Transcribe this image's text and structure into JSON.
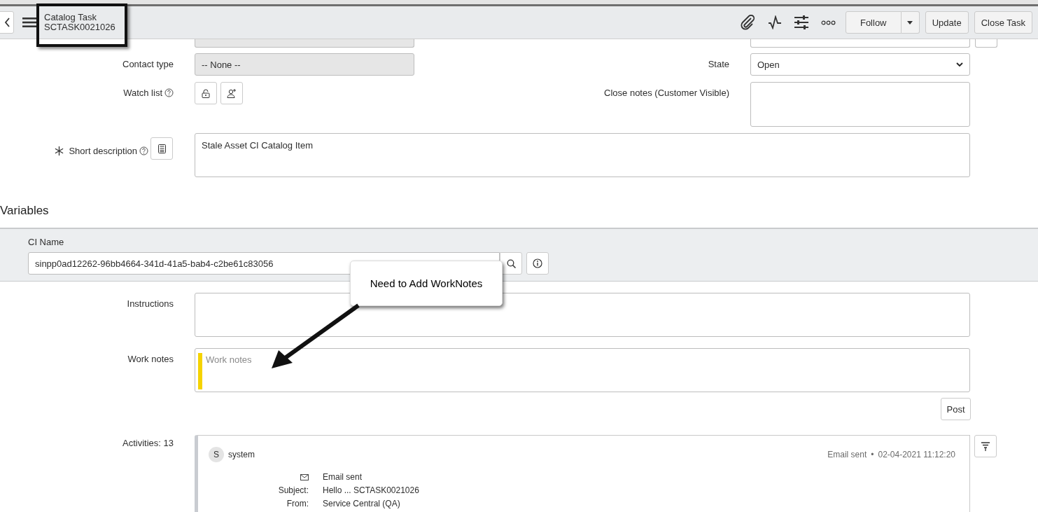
{
  "header": {
    "title": "Catalog Task",
    "number": "SCTASK0021026",
    "follow": {
      "label": "Follow"
    },
    "buttons": [
      {
        "label": "Update"
      },
      {
        "label": "Close Task"
      }
    ]
  },
  "form": {
    "contact_type": {
      "label": "Contact type",
      "value": "-- None --",
      "readonly": true
    },
    "state": {
      "label": "State",
      "value": "Open"
    },
    "watch_list": {
      "label": "Watch list"
    },
    "close_notes": {
      "label": "Close notes (Customer Visible)"
    },
    "short_description": {
      "label": "Short description",
      "required": true,
      "value": "Stale Asset CI Catalog Item"
    }
  },
  "variables": {
    "title": "Variables",
    "ci_name": {
      "label": "CI Name",
      "value": "sinpp0ad12262-96bb4664-341d-41a5-bab4-c2be61c83056"
    }
  },
  "instructions": {
    "label": "Instructions"
  },
  "work_notes": {
    "label": "Work notes",
    "placeholder": "Work notes",
    "button": "Post"
  },
  "activities": {
    "label": "Activities: 13",
    "entries": [
      {
        "avatar": "S",
        "author": "system",
        "type": "Email sent",
        "separator": "•",
        "time": "02-04-2021 11:12:20",
        "lines": [
          {
            "kind": "email",
            "value": "Email sent"
          },
          {
            "kind": "field",
            "label": "Subject:",
            "value": "Hello ... SCTASK0021026"
          },
          {
            "kind": "field",
            "label": "From:",
            "value": "Service Central (QA)"
          }
        ]
      }
    ]
  },
  "callout": {
    "text": "Need to Add WorkNotes"
  }
}
